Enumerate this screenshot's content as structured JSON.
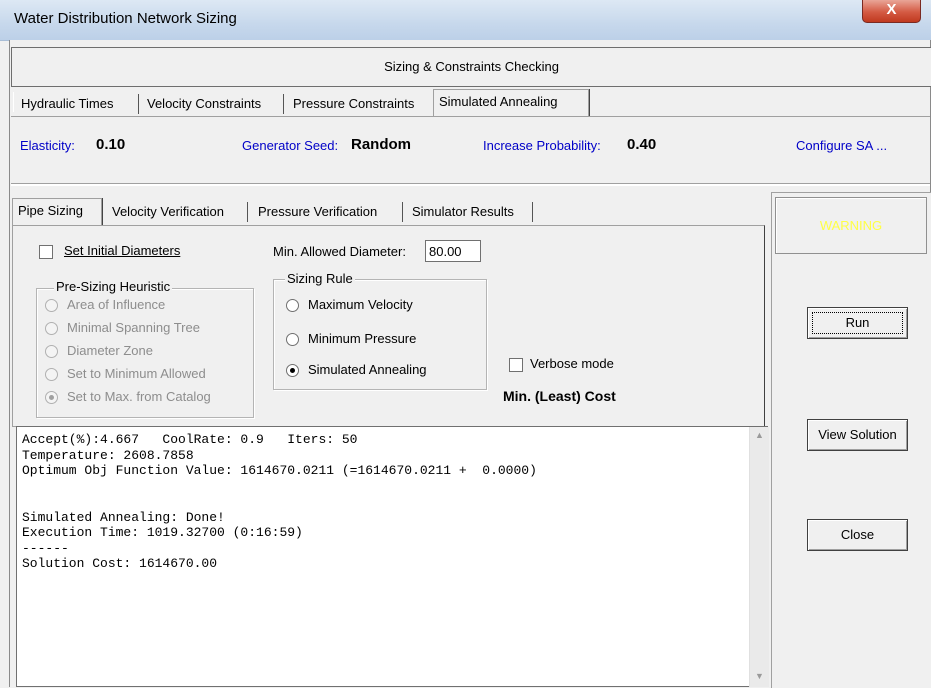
{
  "window": {
    "title": "Water Distribution Network Sizing",
    "close_glyph": "X"
  },
  "header": {
    "title": "Sizing & Constraints Checking"
  },
  "top_tabs": [
    {
      "label": "Hydraulic Times"
    },
    {
      "label": "Velocity Constraints"
    },
    {
      "label": "Pressure Constraints"
    },
    {
      "label": "Simulated Annealing"
    }
  ],
  "sa_params": {
    "elasticity_label": "Elasticity:",
    "elasticity_value": "0.10",
    "seed_label": "Generator Seed:",
    "seed_value": "Random",
    "increase_label": "Increase Probability:",
    "increase_value": "0.40",
    "configure_link": "Configure SA ..."
  },
  "inner_tabs": [
    {
      "label": "Pipe Sizing"
    },
    {
      "label": "Velocity Verification"
    },
    {
      "label": "Pressure Verification"
    },
    {
      "label": "Simulator Results"
    }
  ],
  "pipe_sizing": {
    "set_initial_diameters": "Set Initial Diameters",
    "set_initial_checked": false,
    "min_diameter_label": "Min. Allowed Diameter:",
    "min_diameter_value": "80.00",
    "heuristic_title": "Pre-Sizing Heuristic",
    "heuristic_options": [
      {
        "label": "Area of Influence",
        "selected": false
      },
      {
        "label": "Minimal Spanning Tree",
        "selected": false
      },
      {
        "label": "Diameter Zone",
        "selected": false
      },
      {
        "label": "Set to Minimum Allowed",
        "selected": false
      },
      {
        "label": "Set to Max. from Catalog",
        "selected": true
      }
    ],
    "sizing_rule_title": "Sizing Rule",
    "sizing_rule_options": [
      {
        "label": "Maximum Velocity",
        "selected": false
      },
      {
        "label": "Minimum Pressure",
        "selected": false
      },
      {
        "label": "Simulated Annealing",
        "selected": true
      }
    ],
    "verbose_label": "Verbose mode",
    "verbose_checked": false,
    "cost_label": "Min. (Least) Cost"
  },
  "right_panel": {
    "warning": "WARNING",
    "run_button": "Run",
    "view_solution_button": "View Solution",
    "close_button": "Close"
  },
  "output_lines": [
    "Accept(%):4.667   CoolRate: 0.9   Iters: 50",
    "Temperature: 2608.7858",
    "Optimum Obj Function Value: 1614670.0211 (=1614670.0211 +  0.0000)",
    "",
    "",
    "Simulated Annealing: Done!",
    "Execution Time: 1019.32700 (0:16:59)",
    "------",
    "Solution Cost: 1614670.00"
  ],
  "colors": {
    "link_blue": "#0000c8",
    "warning_yellow": "#ffff44",
    "close_red": "#c0391f"
  }
}
